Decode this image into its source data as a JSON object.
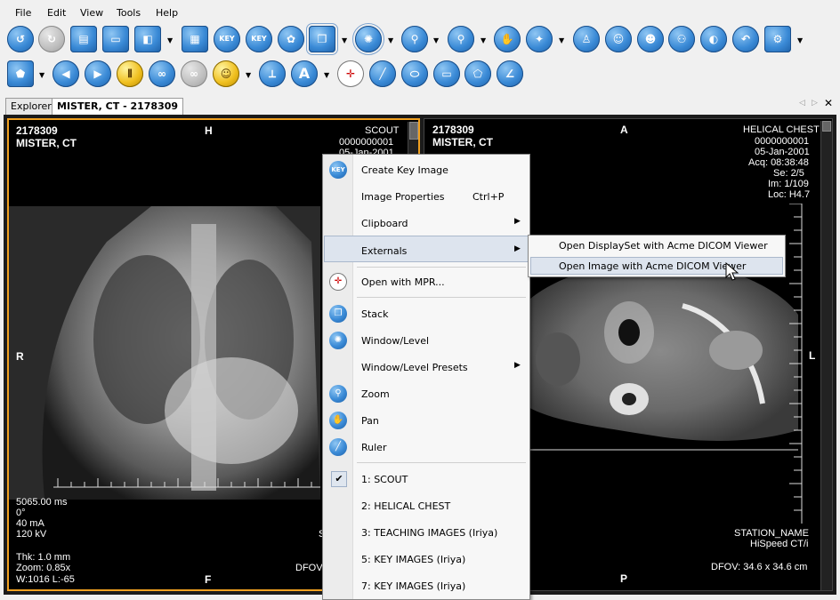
{
  "menubar": {
    "items": [
      "File",
      "Edit",
      "View",
      "Tools",
      "Help"
    ]
  },
  "toolbar": {
    "row1_icons": [
      "reset-icon",
      "redo-icon",
      "clipboard-icon",
      "layout-icon",
      "tile-icon",
      "key-image-icon",
      "key-icon",
      "key-disk-icon",
      "film-icon",
      "stack-icon",
      "window-level-icon",
      "zoom-icon",
      "probe-icon",
      "pan-icon",
      "roi-icon",
      "patient-icon",
      "faces-icon",
      "users-icon",
      "people-icon",
      "contrast-icon",
      "undo-icon",
      "settings-icon"
    ],
    "row2_icons": [
      "polygon-icon",
      "previous-icon",
      "next-icon",
      "cine-icon",
      "link-icon",
      "sync-icon",
      "smile-icon",
      "angle-icon",
      "text-icon",
      "mpr-icon",
      "line-icon",
      "ellipse-icon",
      "rectangle-icon",
      "polygon-roi-icon",
      "protractor-icon"
    ],
    "key_label": "KEY",
    "text_label": "A"
  },
  "tabs": [
    {
      "label": "Explorer"
    },
    {
      "label": "MISTER, CT - 2178309"
    }
  ],
  "viewport_left": {
    "patient_id": "2178309",
    "patient_name": "MISTER, CT",
    "top_orientation": "H",
    "series_desc": "SCOUT",
    "accession": "0000000001",
    "date": "05-Jan-2001",
    "left_orientation": "R",
    "bottom_orientation": "F",
    "exposure_time": "5065.00 ms",
    "angle": "0°",
    "current": "40 mA",
    "voltage": "120 kV",
    "thickness": "Thk: 1.0 mm",
    "zoom": "Zoom: 0.85x",
    "window_level": "W:1016 L:-65",
    "dfov_partial": "DFOV",
    "station_partial": "S"
  },
  "viewport_right": {
    "patient_id": "2178309",
    "patient_name": "MISTER, CT",
    "top_orientation": "A",
    "series_desc": "HELICAL CHEST",
    "accession": "0000000001",
    "date": "05-Jan-2001",
    "acquisition": "Acq: 08:38:48",
    "series_no": "Se: 2/5",
    "image_no": "Im: 1/109",
    "location": "Loc: H4.7",
    "right_orientation": "L",
    "bottom_orientation": "P",
    "station": "STATION_NAME",
    "model": "HiSpeed CT/i",
    "dfov": "DFOV: 34.6 x 34.6 cm"
  },
  "context_menu": {
    "items": [
      {
        "label": "Create Key Image",
        "icon": "key-image-icon"
      },
      {
        "label": "Image Properties",
        "shortcut": "Ctrl+P"
      },
      {
        "label": "Clipboard",
        "submenu": true
      },
      {
        "label": "Externals",
        "submenu": true,
        "highlighted": true
      },
      {
        "label": "Open with MPR...",
        "icon": "mpr-icon"
      },
      {
        "label": "Stack",
        "icon": "stack-icon"
      },
      {
        "label": "Window/Level",
        "icon": "window-level-icon"
      },
      {
        "label": "Window/Level Presets",
        "submenu": true
      },
      {
        "label": "Zoom",
        "icon": "zoom-icon"
      },
      {
        "label": "Pan",
        "icon": "pan-icon"
      },
      {
        "label": "Ruler",
        "icon": "ruler-icon"
      },
      {
        "label": "1: SCOUT",
        "checked": true
      },
      {
        "label": "2: HELICAL CHEST"
      },
      {
        "label": "3: TEACHING IMAGES (Iriya)"
      },
      {
        "label": "5: KEY IMAGES (Iriya)"
      },
      {
        "label": "7: KEY IMAGES (Iriya)"
      }
    ]
  },
  "submenu_externals": {
    "items": [
      {
        "label": "Open DisplaySet with Acme DICOM Viewer"
      },
      {
        "label": "Open Image with Acme DICOM Viewer",
        "highlighted": true
      }
    ]
  },
  "colors": {
    "active_viewport_border": "#f0a020",
    "menu_highlight": "#dde4ee",
    "toolbar_blue": "#3a8ad6"
  }
}
